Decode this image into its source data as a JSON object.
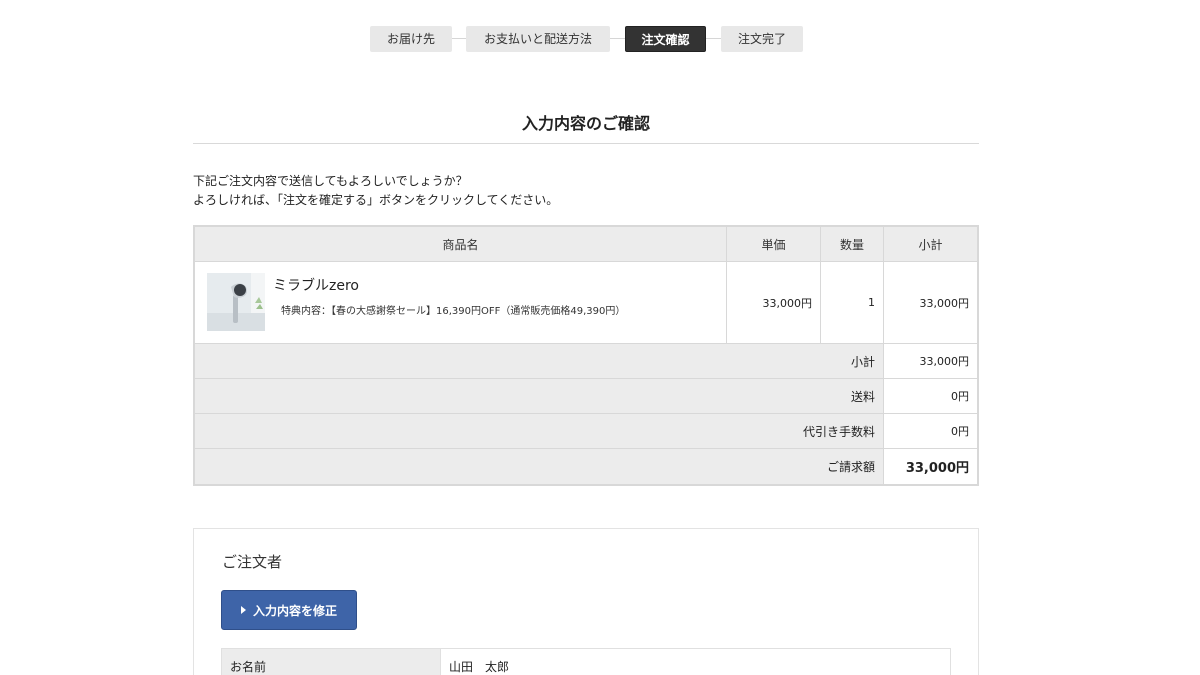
{
  "steps": [
    {
      "label": "お届け先",
      "active": false
    },
    {
      "label": "お支払いと配送方法",
      "active": false
    },
    {
      "label": "注文確認",
      "active": true
    },
    {
      "label": "注文完了",
      "active": false
    }
  ],
  "page_title": "入力内容のご確認",
  "intro": {
    "line1": "下記ご注文内容で送信してもよろしいでしょうか？",
    "line2": "よろしければ、「注文を確定する」ボタンをクリックしてください。"
  },
  "table": {
    "headers": {
      "name": "商品名",
      "unit_price": "単価",
      "quantity": "数量",
      "subtotal": "小計"
    },
    "item": {
      "name": "ミラブルzero",
      "note": "特典内容：【春の大感謝祭セール】16,390円OFF（通常販売価格49,390円）",
      "unit_price": "33,000円",
      "quantity": "1",
      "subtotal": "33,000円"
    },
    "summary": [
      {
        "label": "小計",
        "value": "33,000円"
      },
      {
        "label": "送料",
        "value": "0円"
      },
      {
        "label": "代引き手数料",
        "value": "0円"
      },
      {
        "label": "ご請求額",
        "value": "33,000円"
      }
    ]
  },
  "customer": {
    "title": "ご注文者",
    "edit_button": "入力内容を修正",
    "name_label": "お名前",
    "name_value": "山田　太郎"
  }
}
